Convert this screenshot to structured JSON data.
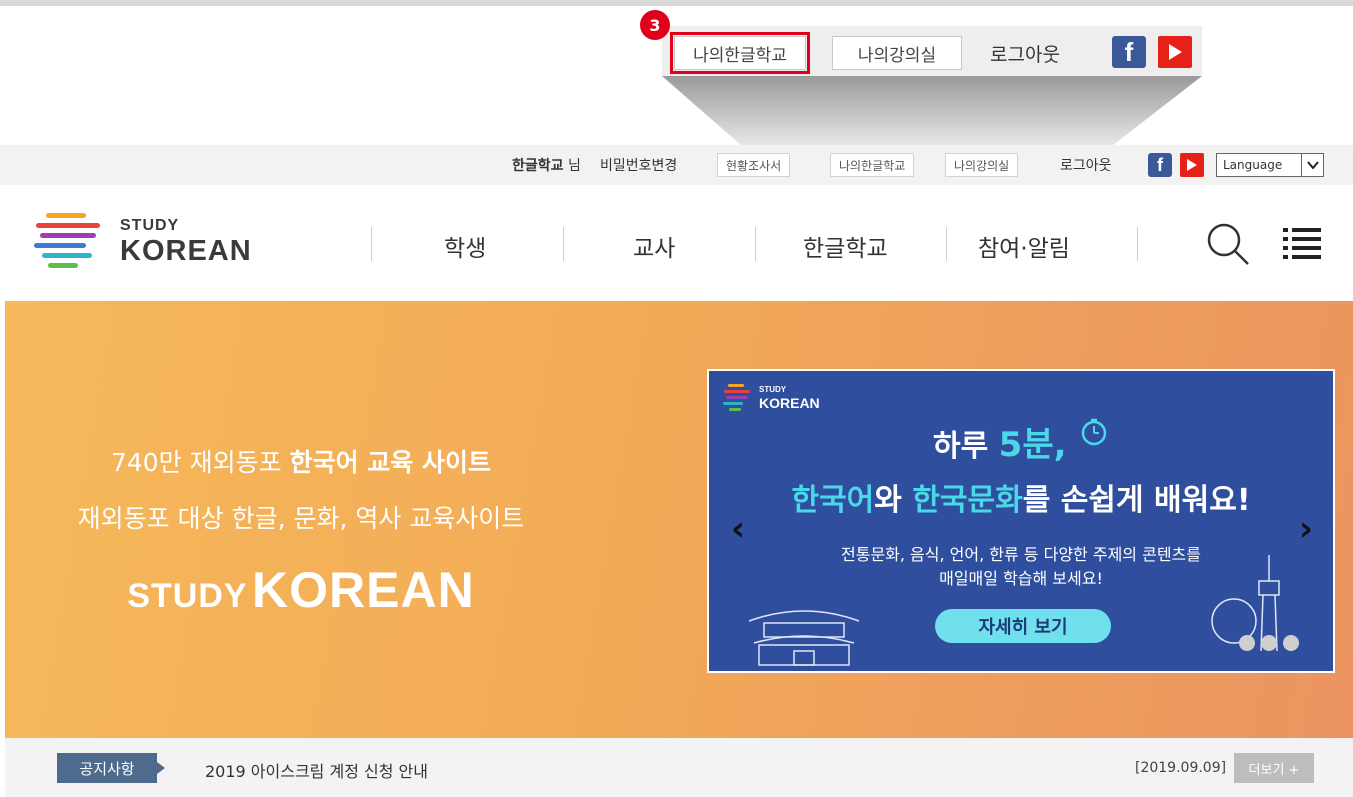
{
  "callout": {
    "badge": "3",
    "my_school": "나의한글학교",
    "my_classroom": "나의강의실",
    "logout": "로그아웃"
  },
  "utility": {
    "username": "한글학교",
    "username_suffix": "님",
    "change_password": "비밀번호변경",
    "survey": "현황조사서",
    "my_school": "나의한글학교",
    "my_classroom": "나의강의실",
    "logout": "로그아웃",
    "language": "Language"
  },
  "header": {
    "logo_study": "STUDY",
    "logo_korean": "KOREAN",
    "nav": [
      "학생",
      "교사",
      "한글학교",
      "참여·알림"
    ]
  },
  "hero": {
    "line1_plain": "740만 재외동포 ",
    "line1_bold": "한국어 교육 사이트",
    "line2": "재외동포 대상 한글, 문화, 역사 교육사이트",
    "brand_study": "STUDY",
    "brand_korean": "KOREAN"
  },
  "banner": {
    "logo_study": "STUDY",
    "logo_korean": "KOREAN",
    "title1_a": "하루 ",
    "title1_b": "5분,",
    "title2_a": "한국어",
    "title2_b": "와 ",
    "title2_c": "한국문화",
    "title2_d": "를 손쉽게 배워요!",
    "desc1": "전통문화, 음식, 언어, 한류 등 다양한 주제의 콘텐츠를",
    "desc2": "매일매일 학습해 보세요!",
    "button": "자세히 보기",
    "prev": "‹",
    "next": "›"
  },
  "notice": {
    "label": "공지사항",
    "text": "2019 아이스크림 계정 신청 안내",
    "date": "[2019.09.09]",
    "more": "더보기 +"
  },
  "colors": {
    "highlight": "#e0001b",
    "banner_bg": "#2f4f9e",
    "accent_cyan": "#4ad8e8",
    "notice_label": "#4e6a8d",
    "facebook": "#3b5998",
    "youtube": "#e62117"
  }
}
